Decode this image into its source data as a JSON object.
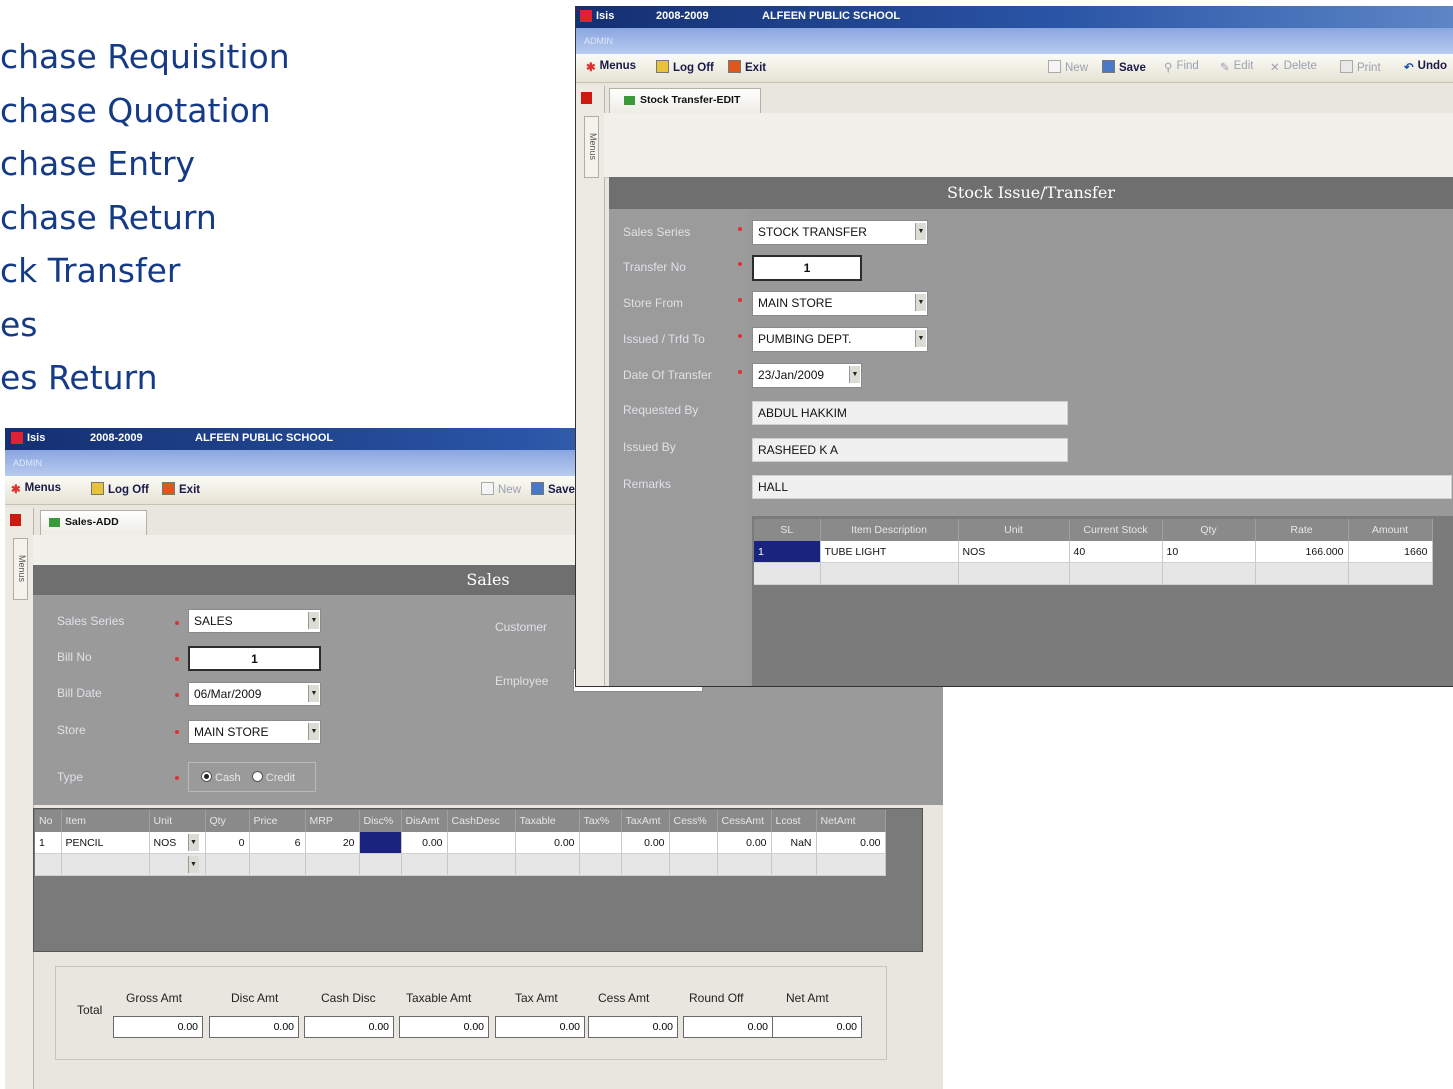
{
  "bullets": [
    "chase Requisition",
    "chase Quotation",
    "chase Entry",
    "chase Return",
    "ck Transfer",
    "es",
    "es Return"
  ],
  "sales_window": {
    "title_app": "Isis",
    "title_year": "2008-2009",
    "title_school": "ALFEEN PUBLIC SCHOOL",
    "user": "ADMIN",
    "menus": "Menus",
    "logoff": "Log Off",
    "exit": "Exit",
    "new": "New",
    "save": "Save",
    "menus_tab": "Menus",
    "tab": "Sales-ADD",
    "header": "Sales",
    "labels": {
      "series": "Sales Series",
      "billno": "Bill No",
      "billdate": "Bill Date",
      "store": "Store",
      "type": "Type",
      "customer": "Customer",
      "employee": "Employee"
    },
    "values": {
      "series": "SALES",
      "billno": "1",
      "billdate": "06/Mar/2009",
      "store": "MAIN STORE",
      "type_cash": "Cash",
      "type_credit": "Credit"
    },
    "grid": {
      "columns": [
        "No",
        "Item",
        "Unit",
        "Qty",
        "Price",
        "MRP",
        "Disc%",
        "DisAmt",
        "CashDesc",
        "Taxable",
        "Tax%",
        "TaxAmt",
        "Cess%",
        "CessAmt",
        "Lcost",
        "NetAmt"
      ],
      "rows": [
        [
          "1",
          "PENCIL",
          "NOS",
          "0",
          "6",
          "20",
          "",
          "0.00",
          "",
          "0.00",
          "",
          "0.00",
          "",
          "0.00",
          "NaN",
          "0.00"
        ]
      ]
    },
    "totals": {
      "label": "Total",
      "columns": [
        "Gross Amt",
        "Disc Amt",
        "Cash Disc",
        "Taxable Amt",
        "Tax Amt",
        "Cess Amt",
        "Round Off",
        "Net Amt"
      ],
      "values": [
        "0.00",
        "0.00",
        "0.00",
        "0.00",
        "0.00",
        "0.00",
        "0.00",
        "0.00"
      ]
    }
  },
  "transfer_window": {
    "title_app": "Isis",
    "title_year": "2008-2009",
    "title_school": "ALFEEN PUBLIC SCHOOL",
    "user": "ADMIN",
    "menus": "Menus",
    "logoff": "Log Off",
    "exit": "Exit",
    "toolbar": {
      "new": "New",
      "save": "Save",
      "find": "Find",
      "edit": "Edit",
      "delete": "Delete",
      "print": "Print",
      "undo": "Undo"
    },
    "menus_tab": "Menus",
    "tab": "Stock Transfer-EDIT",
    "header": "Stock Issue/Transfer",
    "labels": {
      "series": "Sales Series",
      "transfer_no": "Transfer No",
      "store_from": "Store  From",
      "issued_to": "Issued / Trfd To",
      "date": "Date Of Transfer",
      "requested_by": "Requested By",
      "issued_by": "Issued By",
      "remarks": "Remarks"
    },
    "values": {
      "series": "STOCK TRANSFER",
      "transfer_no": "1",
      "store_from": "MAIN STORE",
      "issued_to": "PUMBING DEPT.",
      "date": "23/Jan/2009",
      "requested_by": "ABDUL HAKKIM",
      "issued_by": "RASHEED K A",
      "remarks": "HALL"
    },
    "grid": {
      "columns": [
        "SL",
        "Item Description",
        "Unit",
        "Current Stock",
        "Qty",
        "Rate",
        "Amount"
      ],
      "rows": [
        [
          "1",
          "TUBE LIGHT",
          "NOS",
          "40",
          "10",
          "166.000",
          "1660"
        ]
      ]
    }
  }
}
